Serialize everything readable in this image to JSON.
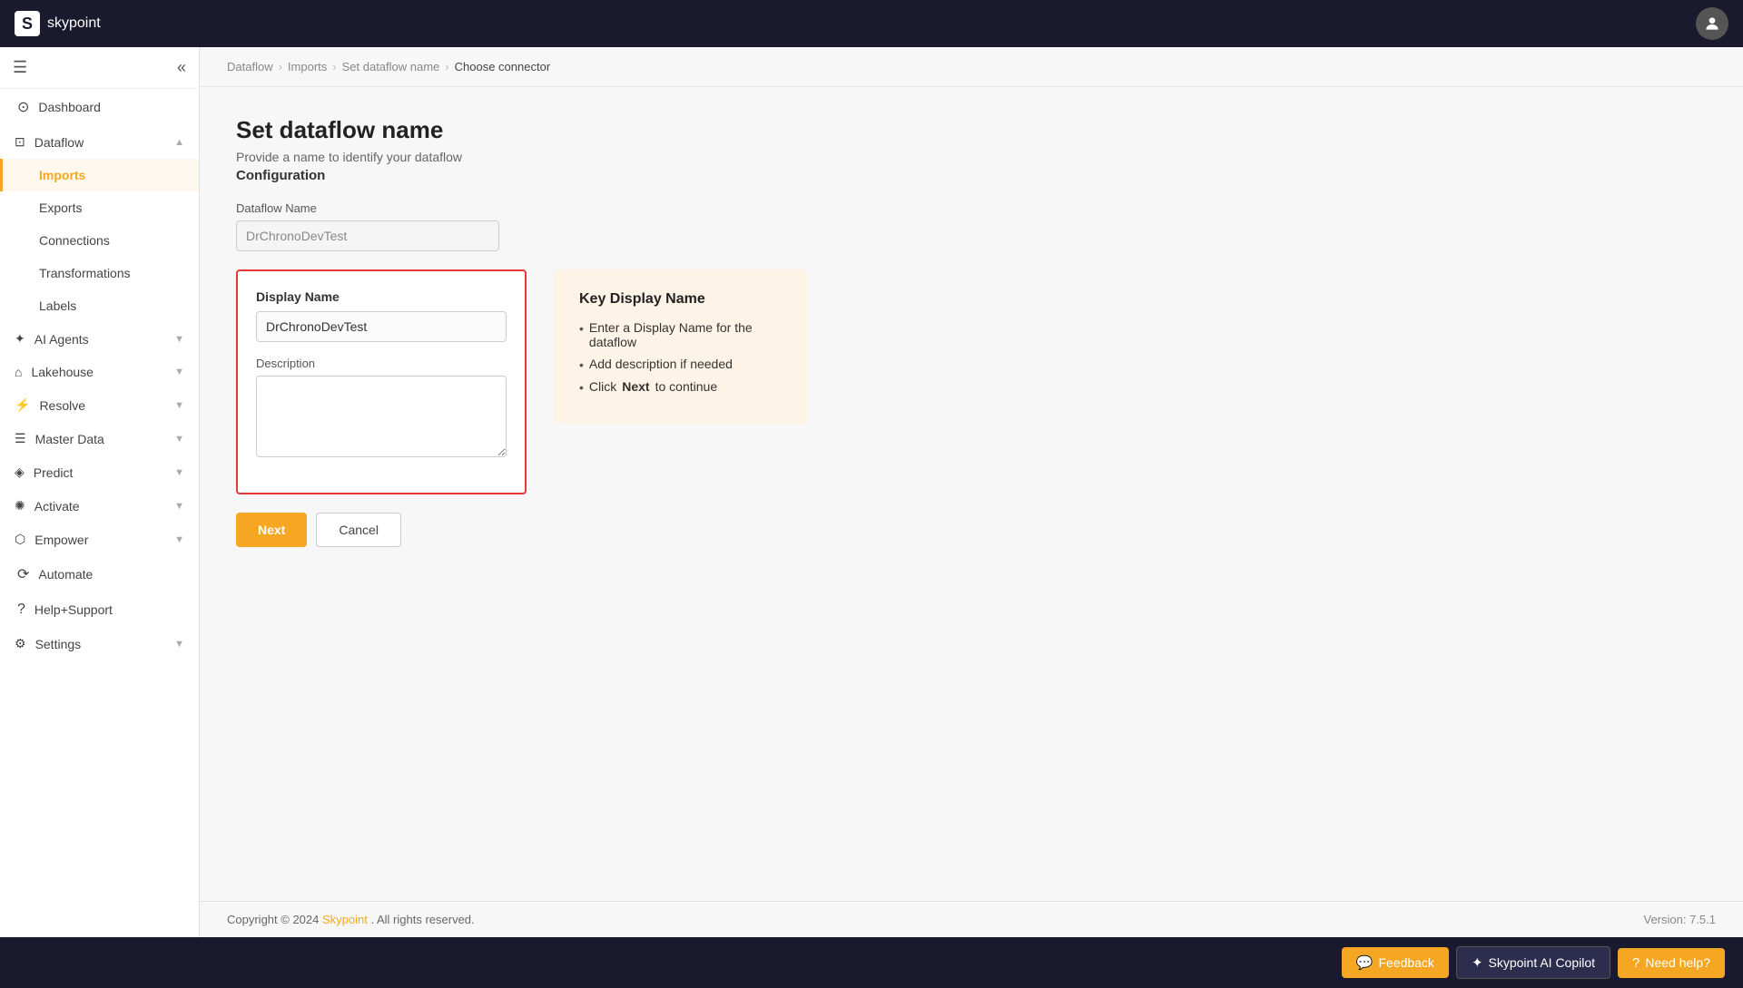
{
  "app": {
    "name": "skypoint",
    "logo_letter": "S"
  },
  "breadcrumb": {
    "items": [
      "Dataflow",
      "Imports",
      "Set dataflow name",
      "Choose connector"
    ],
    "current": "Choose connector"
  },
  "page": {
    "title": "Set dataflow name",
    "subtitle": "Provide a name to identify your dataflow",
    "section_title": "Configuration",
    "dataflow_name_label": "Dataflow Name",
    "dataflow_name_value": "DrChronoDevTest",
    "display_name_label": "Display Name",
    "display_name_value": "DrChronoDevTest",
    "description_label": "Description",
    "description_value": ""
  },
  "buttons": {
    "next": "Next",
    "cancel": "Cancel"
  },
  "hint": {
    "title": "Key Display Name",
    "items": [
      "Enter a Display Name for the dataflow",
      "Add description if needed",
      "Click Next to continue"
    ],
    "bold_word": "Next"
  },
  "sidebar": {
    "top_items": [
      {
        "id": "dashboard",
        "label": "Dashboard",
        "icon": "⊙",
        "has_chevron": false
      }
    ],
    "nav_items": [
      {
        "id": "dataflow",
        "label": "Dataflow",
        "icon": "⊡",
        "has_chevron": true,
        "expanded": true,
        "sub_items": [
          {
            "id": "imports",
            "label": "Imports",
            "active": true
          },
          {
            "id": "exports",
            "label": "Exports"
          },
          {
            "id": "connections",
            "label": "Connections"
          },
          {
            "id": "transformations",
            "label": "Transformations"
          },
          {
            "id": "labels",
            "label": "Labels"
          }
        ]
      },
      {
        "id": "ai-agents",
        "label": "AI Agents",
        "icon": "✦",
        "has_chevron": true
      },
      {
        "id": "lakehouse",
        "label": "Lakehouse",
        "icon": "⌂",
        "has_chevron": true
      },
      {
        "id": "resolve",
        "label": "Resolve",
        "icon": "⚡",
        "has_chevron": true
      },
      {
        "id": "master-data",
        "label": "Master Data",
        "icon": "☰",
        "has_chevron": true
      },
      {
        "id": "predict",
        "label": "Predict",
        "icon": "◈",
        "has_chevron": true
      },
      {
        "id": "activate",
        "label": "Activate",
        "icon": "✺",
        "has_chevron": true
      },
      {
        "id": "empower",
        "label": "Empower",
        "icon": "⬡",
        "has_chevron": true
      },
      {
        "id": "automate",
        "label": "Automate",
        "icon": "⟳",
        "has_chevron": false
      },
      {
        "id": "help-support",
        "label": "Help+Support",
        "icon": "?",
        "has_chevron": false
      },
      {
        "id": "settings",
        "label": "Settings",
        "icon": "⚙",
        "has_chevron": true
      }
    ]
  },
  "footer": {
    "copyright": "Copyright © 2024",
    "brand": "Skypoint",
    "rights": ". All rights reserved.",
    "version": "Version: 7.5.1"
  },
  "action_bar": {
    "feedback_label": "Feedback",
    "copilot_label": "Skypoint AI Copilot",
    "help_label": "Need help?"
  }
}
